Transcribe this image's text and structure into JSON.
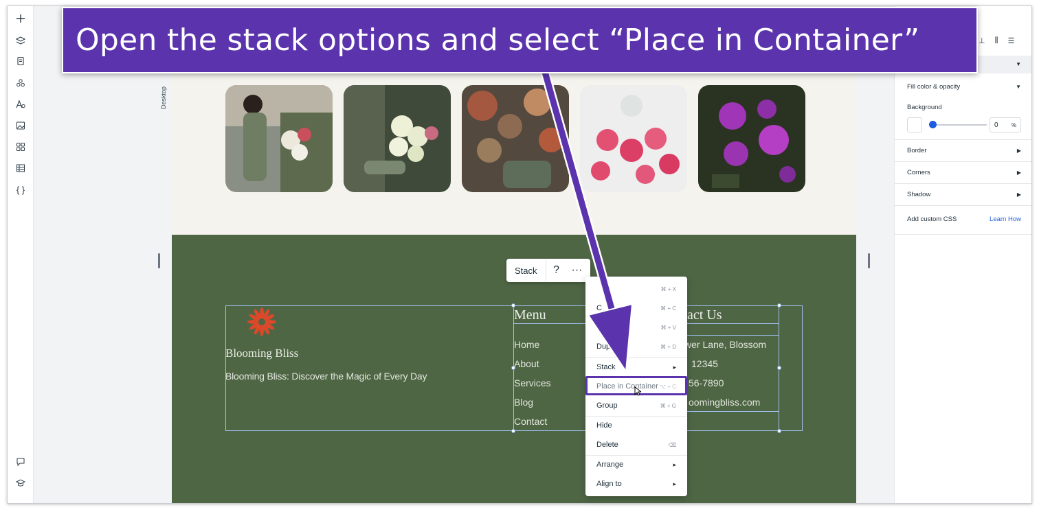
{
  "banner": {
    "text": "Open the stack options and select “Place in Container”"
  },
  "canvas": {
    "view_label": "Desktop"
  },
  "brand": {
    "name": "Blooming Bliss",
    "tagline": "Blooming Bliss: Discover the Magic of Every Day"
  },
  "menu": {
    "title": "Menu",
    "links": [
      "Home",
      "About",
      "Services",
      "Blog",
      "Contact"
    ]
  },
  "contact": {
    "title_visible": "act Us",
    "lines": [
      "wer Lane, Blossom",
      "12345",
      "56-7890",
      "oomingbliss.com"
    ]
  },
  "stack_toolbar": {
    "label": "Stack",
    "help": "?",
    "more": "···"
  },
  "context_menu": {
    "items": [
      {
        "label": "",
        "shortcut": "⌘ + X"
      },
      {
        "label": "C",
        "shortcut": "⌘ + C"
      },
      {
        "label": "",
        "shortcut": "⌘ + V"
      },
      {
        "label": "Dup",
        "shortcut": "⌘ + D"
      },
      {
        "label": "Stack",
        "shortcut": ""
      },
      {
        "label": "Place in Container",
        "shortcut": "⌥ + C"
      },
      {
        "label": "Group",
        "shortcut": "⌘ + G"
      },
      {
        "label": "Hide",
        "shortcut": ""
      },
      {
        "label": "Delete",
        "shortcut": "⌫"
      },
      {
        "label": "Arrange",
        "shortcut": ""
      },
      {
        "label": "Align to",
        "shortcut": ""
      }
    ]
  },
  "right_panel": {
    "fill_label": "Fill color & opacity",
    "background_label": "Background",
    "opacity_value": "0",
    "opacity_unit": "%",
    "opacity_level": 0,
    "border_label": "Border",
    "corners_label": "Corners",
    "shadow_label": "Shadow",
    "custom_css_label": "Add custom CSS",
    "learn_how": "Learn How"
  },
  "colors": {
    "banner": "#5b34ad",
    "footer": "#4f6645",
    "page_bg": "#f5f3ed",
    "accent_blue": "#1d5ce0",
    "logo": "#d9492a"
  }
}
